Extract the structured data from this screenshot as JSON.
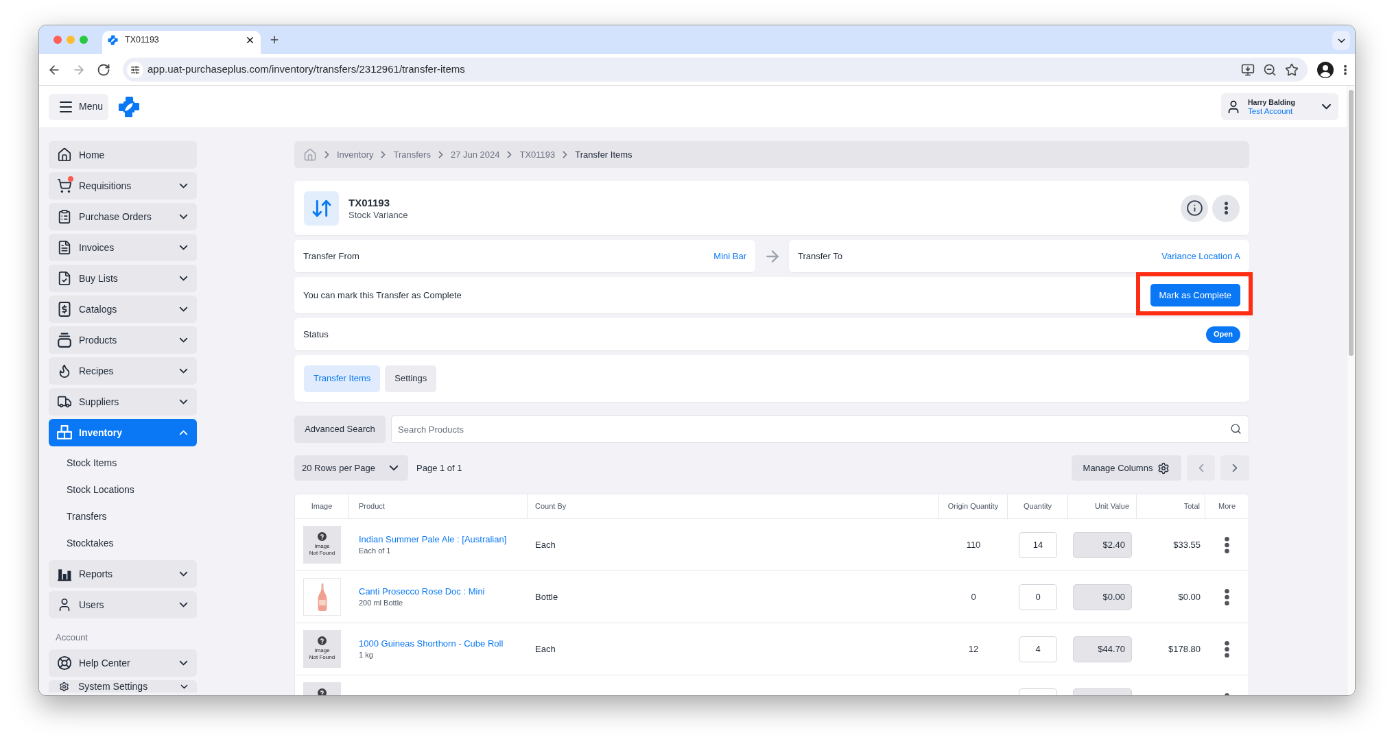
{
  "browser": {
    "tab_title": "TX01193",
    "url": "app.uat-purchaseplus.com/inventory/transfers/2312961/transfer-items"
  },
  "header": {
    "menu_label": "Menu",
    "user": {
      "name": "Harry Balding",
      "account": "Test Account"
    }
  },
  "sidebar": {
    "items": [
      {
        "label": "Home",
        "kind": "link",
        "selected": false,
        "notification": false
      },
      {
        "label": "Requisitions",
        "kind": "group",
        "selected": false,
        "expanded": false,
        "notification": true
      },
      {
        "label": "Purchase Orders",
        "kind": "group",
        "selected": false,
        "expanded": false,
        "notification": false
      },
      {
        "label": "Invoices",
        "kind": "group",
        "selected": false,
        "expanded": false,
        "notification": false
      },
      {
        "label": "Buy Lists",
        "kind": "group",
        "selected": false,
        "expanded": false,
        "notification": false
      },
      {
        "label": "Catalogs",
        "kind": "group",
        "selected": false,
        "expanded": false,
        "notification": false
      },
      {
        "label": "Products",
        "kind": "group",
        "selected": false,
        "expanded": false,
        "notification": false
      },
      {
        "label": "Recipes",
        "kind": "group",
        "selected": false,
        "expanded": false,
        "notification": false
      },
      {
        "label": "Suppliers",
        "kind": "group",
        "selected": false,
        "expanded": false,
        "notification": false
      },
      {
        "label": "Inventory",
        "kind": "group",
        "selected": true,
        "expanded": true,
        "notification": false,
        "children": [
          {
            "label": "Stock Items"
          },
          {
            "label": "Stock Locations"
          },
          {
            "label": "Transfers"
          },
          {
            "label": "Stocktakes"
          }
        ]
      },
      {
        "label": "Reports",
        "kind": "group",
        "selected": false,
        "expanded": false,
        "notification": false
      },
      {
        "label": "Users",
        "kind": "group",
        "selected": false,
        "expanded": false,
        "notification": false
      }
    ],
    "account_section": {
      "title": "Account",
      "items": [
        {
          "label": "Help Center",
          "kind": "group",
          "selected": false,
          "expanded": false,
          "notification": false
        },
        {
          "label": "System Settings",
          "kind": "group",
          "selected": false,
          "expanded": false,
          "notification": false
        }
      ]
    }
  },
  "breadcrumb": [
    {
      "label": "Inventory",
      "current": false
    },
    {
      "label": "Transfers",
      "current": false
    },
    {
      "label": "27 Jun 2024",
      "current": false
    },
    {
      "label": "TX01193",
      "current": false
    },
    {
      "label": "Transfer Items",
      "current": true
    }
  ],
  "transfer": {
    "id": "TX01193",
    "type": "Stock Variance",
    "from": {
      "label": "Transfer From",
      "value": "Mini Bar"
    },
    "to": {
      "label": "Transfer To",
      "value": "Variance Location A"
    }
  },
  "complete_prompt": {
    "message": "You can mark this Transfer as Complete",
    "button": "Mark as Complete",
    "highlighted": true
  },
  "status": {
    "label": "Status",
    "value": "Open"
  },
  "tabs": [
    {
      "label": "Transfer Items",
      "selected": true
    },
    {
      "label": "Settings",
      "selected": false
    }
  ],
  "search": {
    "button": "Advanced Search",
    "placeholder": "Search Products"
  },
  "pagination": {
    "rows_per_page": "20 Rows per Page",
    "page": "Page 1 of 1",
    "manage_columns": "Manage Columns"
  },
  "table": {
    "columns": [
      "Image",
      "Product",
      "Count By",
      "Origin Quantity",
      "Quantity",
      "Unit Value",
      "Total",
      "More"
    ],
    "rows": [
      {
        "image": {
          "kind": "missing",
          "lines": [
            "Image",
            "Not Found"
          ]
        },
        "product": "Indian Summer Pale Ale : [Australian]",
        "detail": "Each of 1",
        "count_by": "Each",
        "origin_quantity": "110",
        "quantity": "14",
        "unit_value": "$2.40",
        "total": "$33.55"
      },
      {
        "image": {
          "kind": "photo"
        },
        "product": "Canti Prosecco Rose Doc : Mini",
        "detail": "200 ml Bottle",
        "count_by": "Bottle",
        "origin_quantity": "0",
        "quantity": "0",
        "unit_value": "$0.00",
        "total": "$0.00"
      },
      {
        "image": {
          "kind": "missing",
          "lines": [
            "Image",
            "Not Found"
          ]
        },
        "product": "1000 Guineas Shorthorn - Cube Roll",
        "detail": "1 kg",
        "count_by": "Each",
        "origin_quantity": "12",
        "quantity": "4",
        "unit_value": "$44.70",
        "total": "$178.80"
      },
      {
        "image": {
          "kind": "missing"
        }
      }
    ]
  }
}
